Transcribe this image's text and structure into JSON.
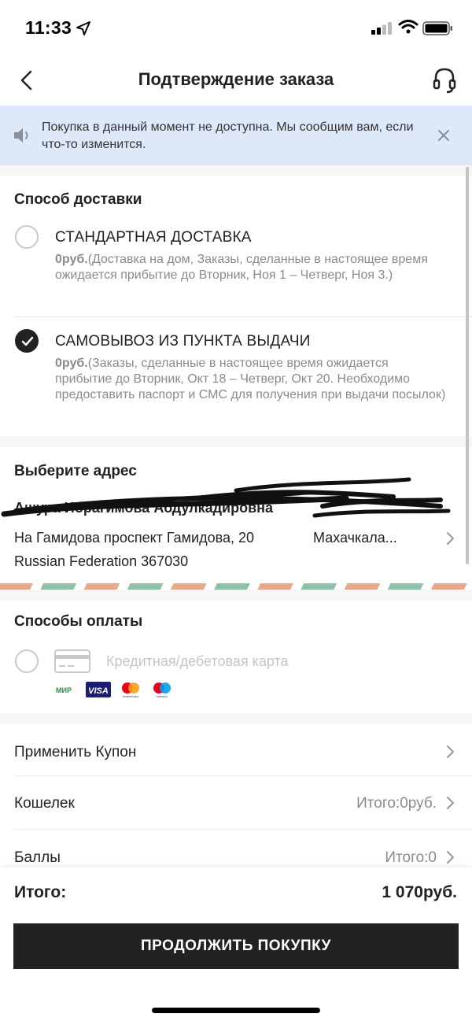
{
  "status_bar": {
    "time": "11:33"
  },
  "header": {
    "title": "Подтверждение заказа"
  },
  "notice": {
    "text": "Покупка в данный момент не доступна. Мы сообщим вам, если что-то изменится."
  },
  "delivery": {
    "title": "Способ доставки",
    "options": [
      {
        "name": "СТАНДАРТНАЯ ДОСТАВКА",
        "price": "0руб.",
        "desc": "(Доставка на дом, Заказы, сделанные в настоящее время ожидается прибытие до Вторник, Ноя 1 – Четверг, Ноя 3.)",
        "selected": false
      },
      {
        "name": "САМОВЫВОЗ ИЗ ПУНКТА ВЫДАЧИ",
        "price": "0руб.",
        "desc": "(Заказы, сделанные в настоящее время ожидается прибытие до Вторник, Окт 18 – Четверг, Окт 20. Необходимо предоставить паспорт и СМС для получения при выдачи посылок)",
        "selected": true
      }
    ]
  },
  "address": {
    "title": "Выберите адрес",
    "name": "Ашура Ибрагимова Абдулкадировна",
    "line1": "На Гамидова проспект Гамидова, 20",
    "city": "Махачкала...",
    "line2": "Russian Federation 367030"
  },
  "payment": {
    "title": "Способы оплаты",
    "card_label": "Кредитная/дебетовая карта",
    "brands": [
      "МИР",
      "VISA",
      "mastercard",
      "maestro"
    ]
  },
  "rows": [
    {
      "label": "Применить Купон",
      "value": ""
    },
    {
      "label": "Кошелек",
      "value": "Итого:0руб."
    },
    {
      "label": "Баллы",
      "value": "Итого:0"
    }
  ],
  "footer": {
    "total_label": "Итого:",
    "total_value": "1 070руб.",
    "cta": "ПРОДОЛЖИТЬ ПОКУПКУ"
  },
  "colors": {
    "notice_bg": "#dde9f9",
    "primary": "#222222",
    "stripe_orange": "#e8a98a",
    "stripe_green": "#8fc0a8"
  }
}
